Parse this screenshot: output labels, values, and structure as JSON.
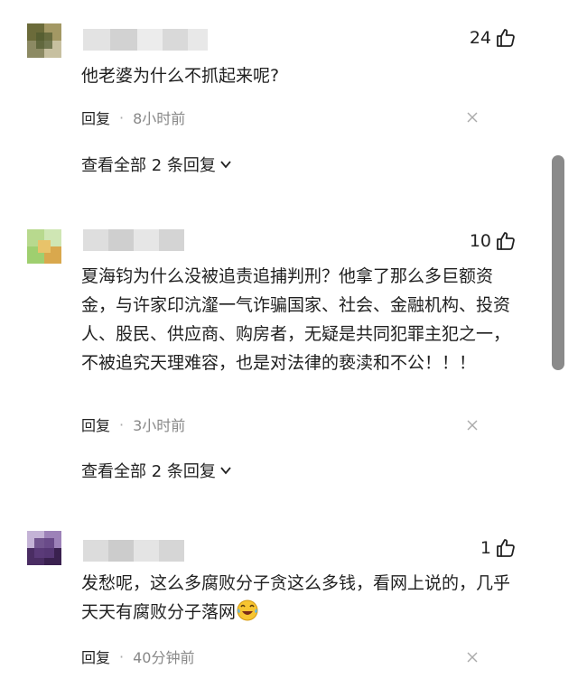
{
  "comments": [
    {
      "likes": "24",
      "text": "他老婆为什么不抓起来呢?",
      "reply_label": "回复",
      "separator": "·",
      "time": "8小时前",
      "view_all": "查看全部 2 条回复",
      "avatar_colors": [
        "#6b6b3a",
        "#a39864",
        "#4e5a2f",
        "#8c8a63",
        "#c7c0a0",
        "#5d6b3d"
      ]
    },
    {
      "likes": "10",
      "text": "夏海钧为什么没被追责追捕判刑？他拿了那么多巨额资金，与许家印沆瀣一气诈骗国家、社会、金融机构、投资人、股民、供应商、购房者，无疑是共同犯罪主犯之一，不被追究天理难容，也是对法律的亵渎和不公！！！",
      "reply_label": "回复",
      "separator": "·",
      "time": "3小时前",
      "view_all": "查看全部 2 条回复",
      "avatar_colors": [
        "#9fcf6f",
        "#e8c36a",
        "#b8d98e",
        "#d9a84d",
        "#cfe6b4",
        "#7fb24e"
      ]
    },
    {
      "likes": "1",
      "text": "发愁呢，这么多腐败分子贪这么多钱，看网上说的，几乎天天有腐败分子落网",
      "reply_label": "回复",
      "separator": "·",
      "time": "40分钟前",
      "avatar_colors": [
        "#4a2d63",
        "#7b5a99",
        "#3a214f",
        "#9d82b8",
        "#5e3d7d",
        "#c4b3d6"
      ]
    }
  ],
  "icons": {
    "like": "thumbs-up-icon",
    "close": "close-icon",
    "expand": "chevron-down-icon",
    "emoji": "laughing-crying-emoji"
  }
}
